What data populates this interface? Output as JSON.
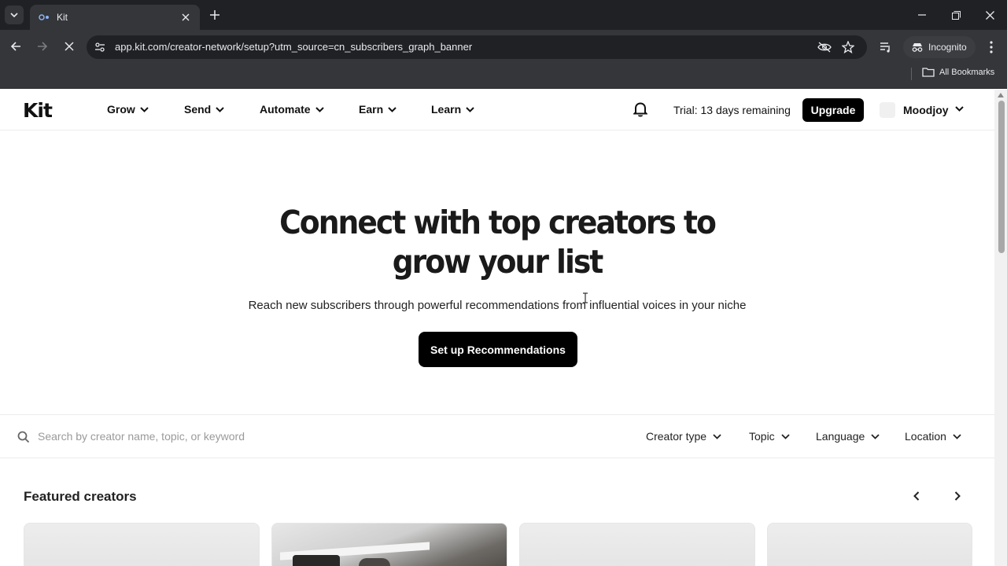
{
  "browser": {
    "tab_title": "Kit",
    "url_host": "app.kit.com",
    "url_path": "/creator-network/setup?utm_source=cn_subscribers_graph_banner",
    "incognito_label": "Incognito",
    "all_bookmarks_label": "All Bookmarks"
  },
  "nav": {
    "logo": "Kit",
    "items": [
      {
        "label": "Grow"
      },
      {
        "label": "Send"
      },
      {
        "label": "Automate"
      },
      {
        "label": "Earn"
      },
      {
        "label": "Learn"
      }
    ],
    "trial_text": "Trial: 13 days remaining",
    "upgrade_label": "Upgrade",
    "user_name": "Moodjoy"
  },
  "hero": {
    "title": "Connect with top creators to grow your list",
    "subtitle": "Reach new subscribers through powerful recommendations from influential voices in your niche",
    "cta_label": "Set up Recommendations"
  },
  "filters": {
    "search_placeholder": "Search by creator name, topic, or keyword",
    "options": [
      {
        "label": "Creator type"
      },
      {
        "label": "Topic"
      },
      {
        "label": "Language"
      },
      {
        "label": "Location"
      }
    ]
  },
  "featured": {
    "title": "Featured creators"
  }
}
